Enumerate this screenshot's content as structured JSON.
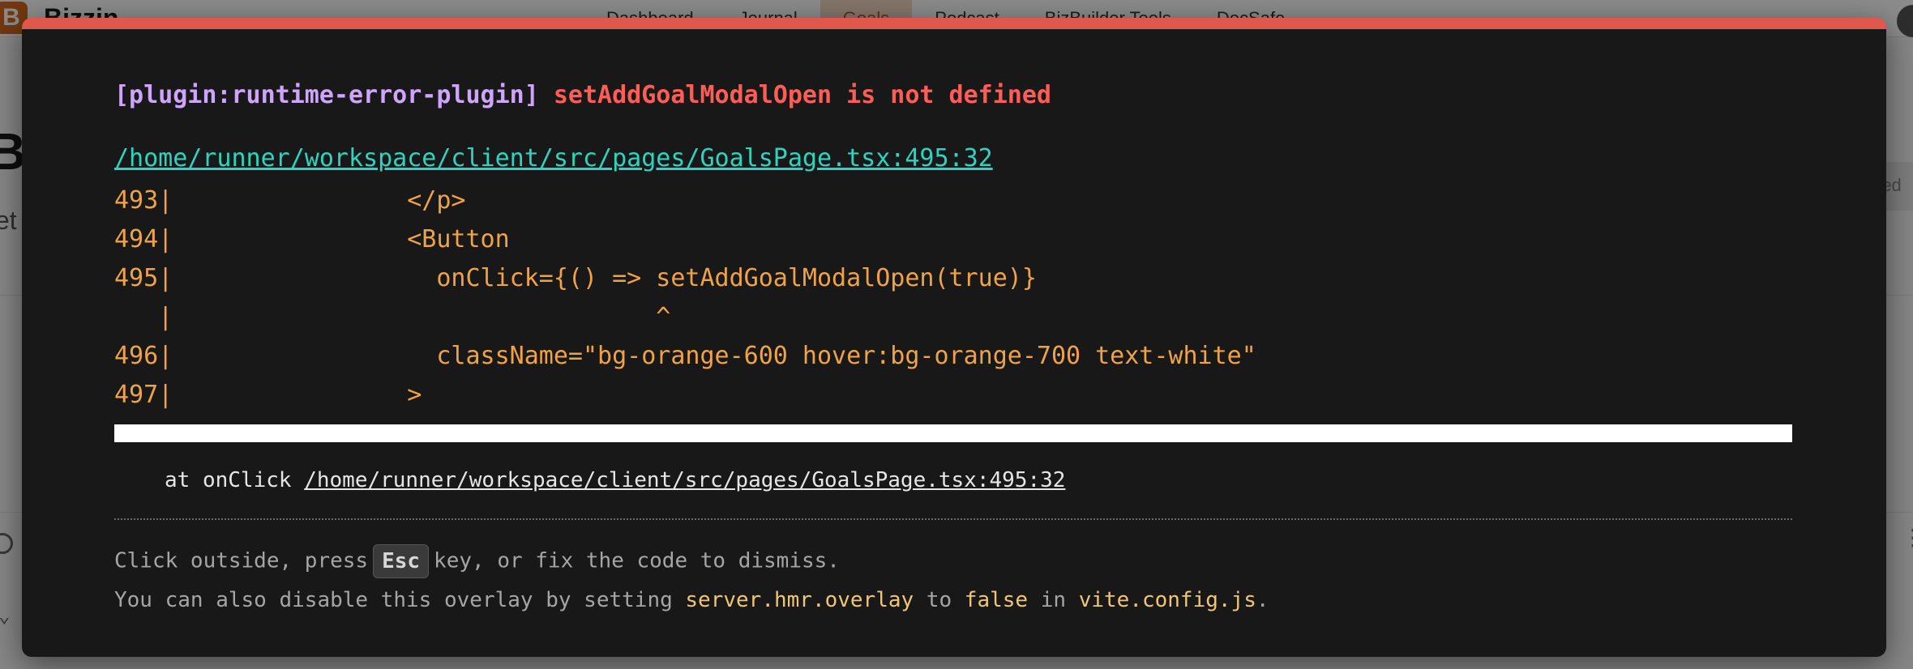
{
  "app": {
    "logo_letter": "B",
    "brand": "Bizzin",
    "nav": [
      {
        "label": "Dashboard",
        "active": false
      },
      {
        "label": "Journal",
        "active": false
      },
      {
        "label": "Goals",
        "active": true
      },
      {
        "label": "Podcast",
        "active": false
      },
      {
        "label": "BizBuilder Tools",
        "active": false
      },
      {
        "label": "DocSafe",
        "active": false
      }
    ],
    "page_title_partial": "Bu",
    "page_subtitle_partial": "et",
    "right_button_partial": "red"
  },
  "overlay": {
    "accent_color": "#e2574c",
    "plugin_tag": "[plugin:runtime-error-plugin]",
    "message": "setAddGoalModalOpen is not defined",
    "file_link": "/home/runner/workspace/client/src/pages/GoalsPage.tsx:495:32",
    "code_frame": [
      "493|                </p>",
      "494|                <Button",
      "495|                  onClick={() => setAddGoalModalOpen(true)}",
      "   |                                 ^",
      "496|                  className=\"bg-orange-600 hover:bg-orange-700 text-white\"",
      "497|                >"
    ],
    "stack_prefix": "at onClick",
    "stack_file": "/home/runner/workspace/client/src/pages/GoalsPage.tsx:495:32",
    "tip_line1": {
      "before": "Click outside, press",
      "key": "Esc",
      "after": "key, or fix the code to dismiss."
    },
    "tip_line2": {
      "t1": "You can also disable this overlay by setting",
      "c1": "server.hmr.overlay",
      "t2": "to",
      "c2": "false",
      "t3": "in",
      "c3": "vite.config.js",
      "t4": "."
    }
  }
}
